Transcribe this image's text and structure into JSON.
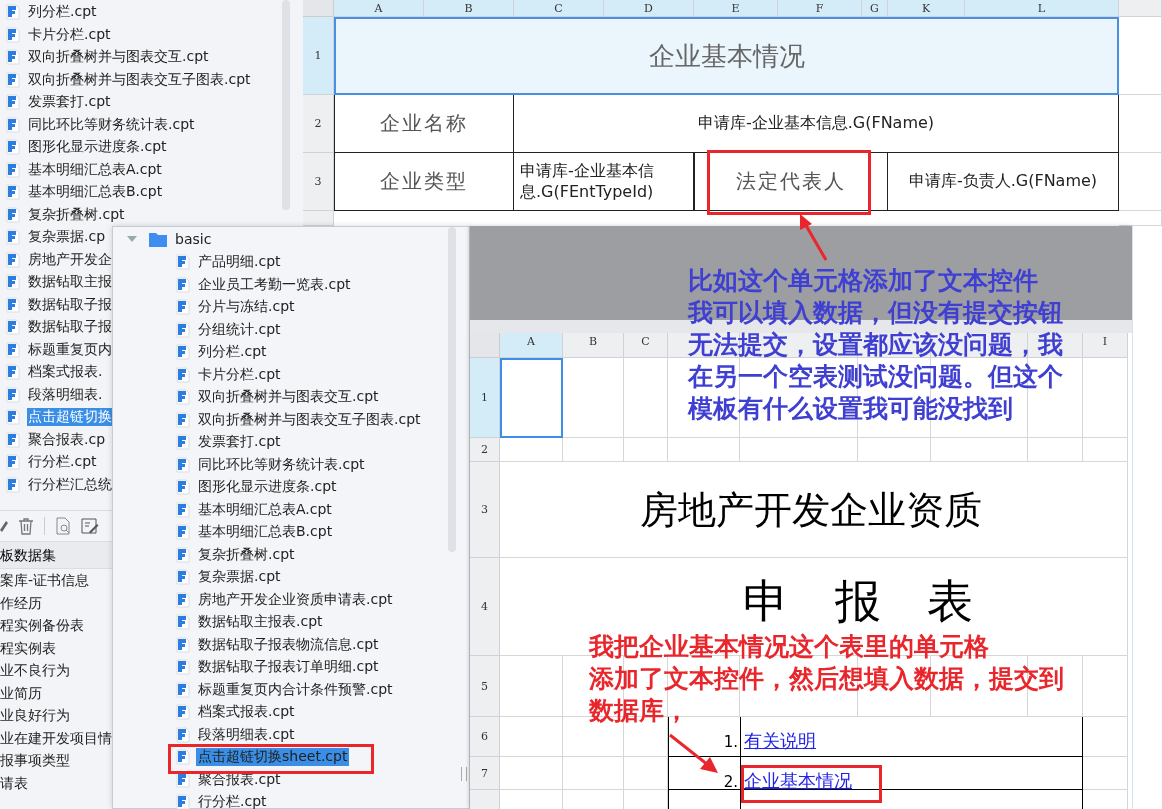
{
  "back_file_list": {
    "items": [
      {
        "label": "列分栏.cpt",
        "selected": false
      },
      {
        "label": "卡片分栏.cpt",
        "selected": false
      },
      {
        "label": "双向折叠树并与图表交互.cpt",
        "selected": false
      },
      {
        "label": "双向折叠树并与图表交互子图表.cpt",
        "selected": false
      },
      {
        "label": "发票套打.cpt",
        "selected": false
      },
      {
        "label": "同比环比等财务统计表.cpt",
        "selected": false
      },
      {
        "label": "图形化显示进度条.cpt",
        "selected": false
      },
      {
        "label": "基本明细汇总表A.cpt",
        "selected": false
      },
      {
        "label": "基本明细汇总表B.cpt",
        "selected": false
      },
      {
        "label": "复杂折叠树.cpt",
        "selected": false
      },
      {
        "label": "复杂票据.cp",
        "selected": false
      },
      {
        "label": "房地产开发企",
        "selected": false
      },
      {
        "label": "数据钻取主报",
        "selected": false
      },
      {
        "label": "数据钻取子报",
        "selected": false
      },
      {
        "label": "数据钻取子报",
        "selected": false
      },
      {
        "label": "标题重复页内",
        "selected": false
      },
      {
        "label": "档案式报表.",
        "selected": false
      },
      {
        "label": "段落明细表.",
        "selected": false
      },
      {
        "label": "点击超链切换",
        "selected": true
      },
      {
        "label": "聚合报表.cp",
        "selected": false
      },
      {
        "label": "行分栏.cpt",
        "selected": false
      },
      {
        "label": "行分栏汇总统",
        "selected": false
      }
    ]
  },
  "dataset_panel": {
    "title": "板数据集",
    "items": [
      "案库-证书信息",
      "作经历",
      "程实例备份表",
      "程实例表",
      "业不良行为",
      "业简历",
      "业良好行为",
      "业在建开发项目情",
      "报事项类型",
      "请表"
    ]
  },
  "top_sheet": {
    "column_headers": [
      "A",
      "B",
      "C",
      "D",
      "E",
      "F",
      "G",
      "K",
      "L"
    ],
    "title_row": {
      "number": "1",
      "text": "企业基本情况",
      "selected": true
    },
    "name_row": {
      "number": "2",
      "label": "企业名称",
      "value": "申请库-企业基本信息.G(FName)"
    },
    "type_row": {
      "number": "3",
      "label": "企业类型",
      "value": "申请库-企业基本信息.G(FEntTypeId)",
      "label_2": "法定代表人",
      "value_2": "申请库-负责人.G(FName)"
    }
  },
  "tree": {
    "folder": {
      "label": "basic",
      "expanded": true
    },
    "items": [
      {
        "label": "产品明细.cpt",
        "selected": false
      },
      {
        "label": "企业员工考勤一览表.cpt",
        "selected": false
      },
      {
        "label": "分片与冻结.cpt",
        "selected": false
      },
      {
        "label": "分组统计.cpt",
        "selected": false
      },
      {
        "label": "列分栏.cpt",
        "selected": false
      },
      {
        "label": "卡片分栏.cpt",
        "selected": false
      },
      {
        "label": "双向折叠树并与图表交互.cpt",
        "selected": false
      },
      {
        "label": "双向折叠树并与图表交互子图表.cpt",
        "selected": false
      },
      {
        "label": "发票套打.cpt",
        "selected": false
      },
      {
        "label": "同比环比等财务统计表.cpt",
        "selected": false
      },
      {
        "label": "图形化显示进度条.cpt",
        "selected": false
      },
      {
        "label": "基本明细汇总表A.cpt",
        "selected": false
      },
      {
        "label": "基本明细汇总表B.cpt",
        "selected": false
      },
      {
        "label": "复杂折叠树.cpt",
        "selected": false
      },
      {
        "label": "复杂票据.cpt",
        "selected": false
      },
      {
        "label": "房地产开发企业资质申请表.cpt",
        "selected": false
      },
      {
        "label": "数据钻取主报表.cpt",
        "selected": false
      },
      {
        "label": "数据钻取子报表物流信息.cpt",
        "selected": false
      },
      {
        "label": "数据钻取子报表订单明细.cpt",
        "selected": false
      },
      {
        "label": "标题重复页内合计条件预警.cpt",
        "selected": false
      },
      {
        "label": "档案式报表.cpt",
        "selected": false
      },
      {
        "label": "段落明细表.cpt",
        "selected": false
      },
      {
        "label": "点击超链切换sheet.cpt",
        "selected": true
      },
      {
        "label": "聚合报表.cpt",
        "selected": false
      },
      {
        "label": "行分栏.cpt",
        "selected": false
      }
    ]
  },
  "front_sheet": {
    "column_headers": [
      {
        "label": "A",
        "selected": true
      },
      {
        "label": "B",
        "selected": false
      },
      {
        "label": "C",
        "selected": false
      },
      {
        "label": "I",
        "selected": false
      }
    ],
    "row_numbers": [
      "1",
      "2",
      "3",
      "4",
      "5",
      "6",
      "7"
    ],
    "a1_selected": true,
    "title": "房地产开发企业资质",
    "subtitle": "申　报　表",
    "toc": [
      {
        "number": "1.",
        "text": "有关说明"
      },
      {
        "number": "2.",
        "text": "企业基本情况"
      }
    ]
  },
  "annotations": [
    {
      "color": "#3f3fd2",
      "lines": [
        "比如这个单元格添加了文本控件",
        "我可以填入数据，但没有提交按钮",
        "无法提交，设置都应该没问题，我",
        "在另一个空表测试没问题。但这个",
        "模板有什么设置我可能没找到"
      ]
    },
    {
      "color": "#e8262b",
      "lines": [
        "我把企业基本情况这个表里的单元格",
        "添加了文本控件，然后想填入数据，提交到",
        "数据库，"
      ]
    }
  ]
}
